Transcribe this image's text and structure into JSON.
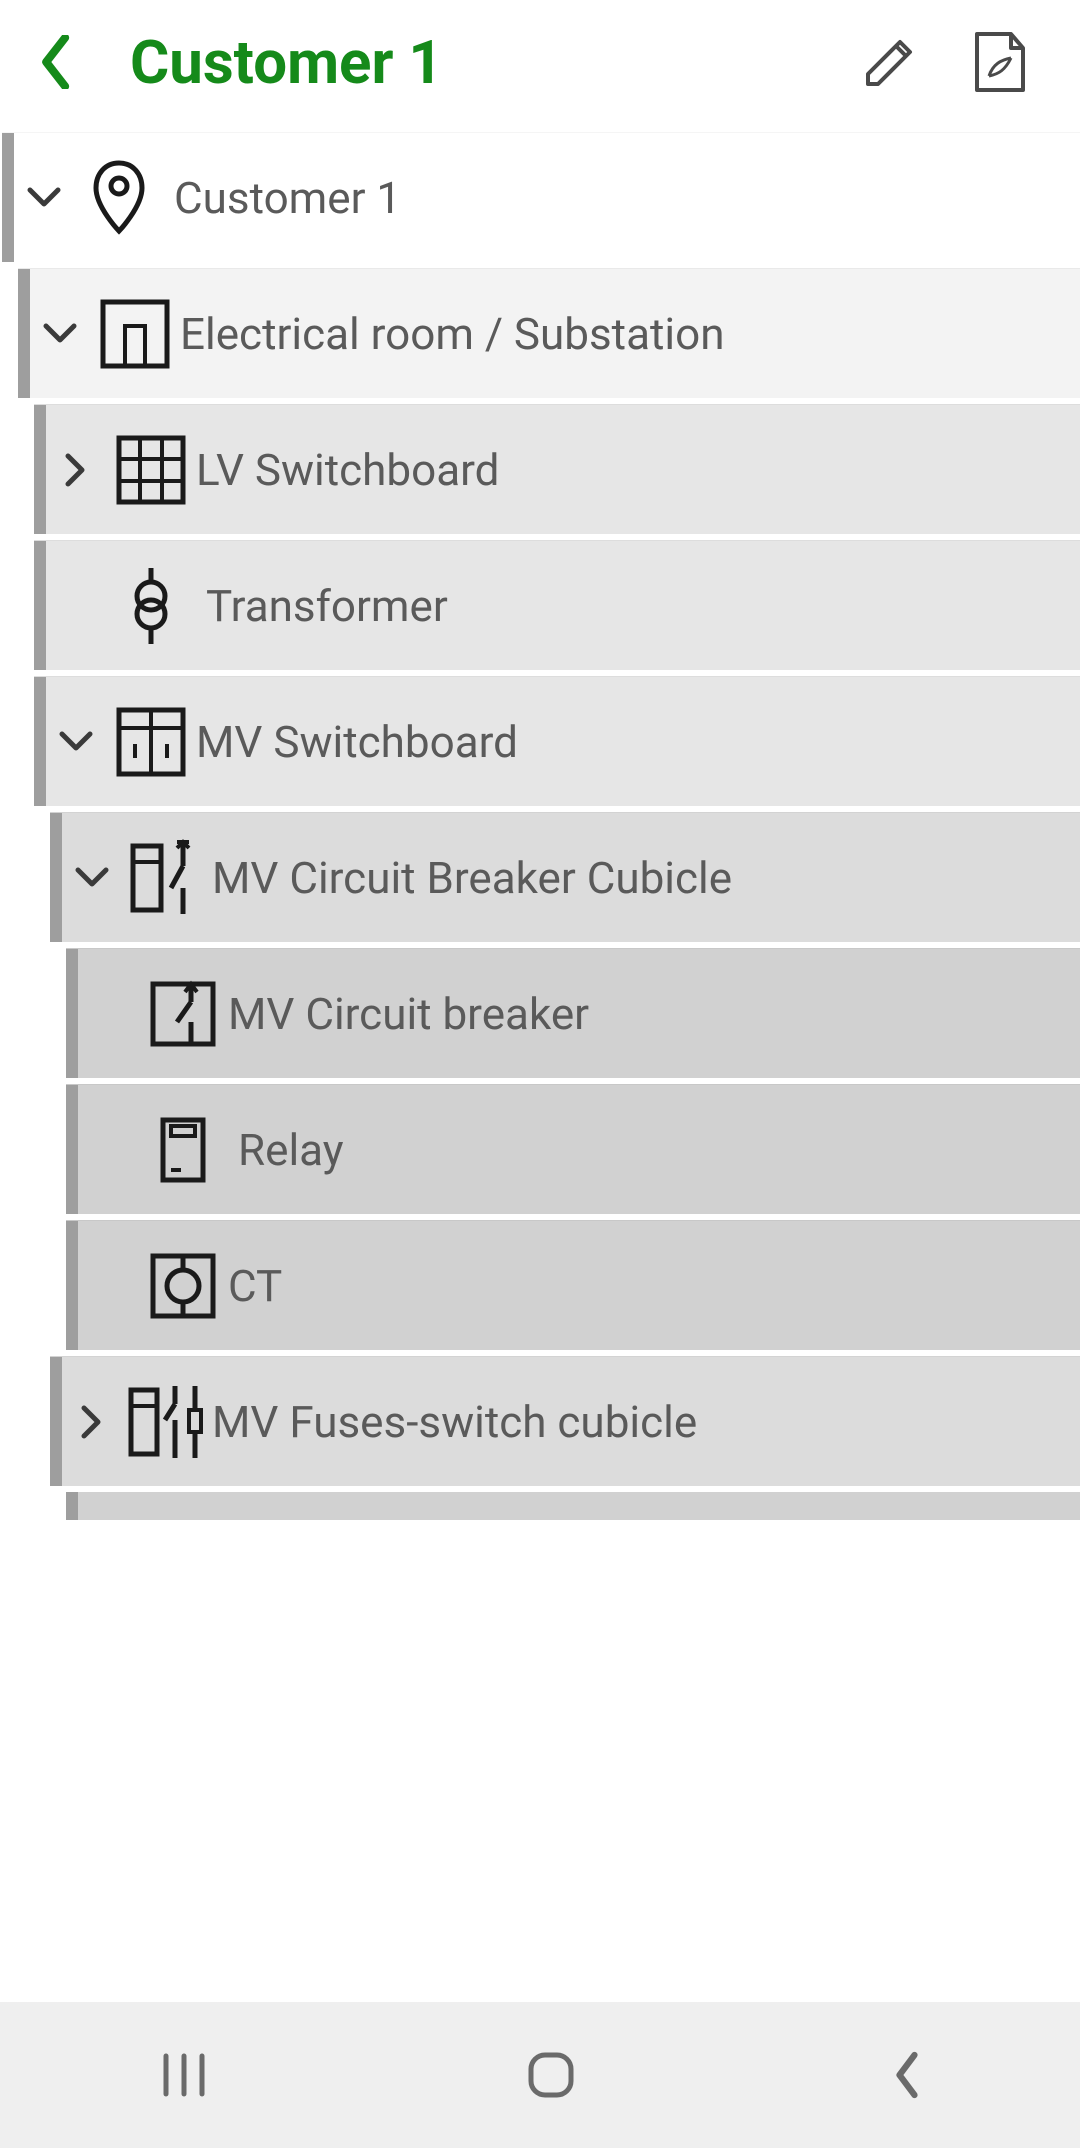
{
  "header": {
    "title": "Customer 1"
  },
  "tree": {
    "root": {
      "label": "Customer 1",
      "children": [
        {
          "label": "Electrical room / Substation",
          "children": [
            {
              "label": "LV Switchboard"
            },
            {
              "label": "Transformer"
            },
            {
              "label": "MV Switchboard",
              "children": [
                {
                  "label": "MV Circuit Breaker Cubicle",
                  "children": [
                    {
                      "label": "MV Circuit breaker"
                    },
                    {
                      "label": "Relay"
                    },
                    {
                      "label": "CT"
                    }
                  ]
                },
                {
                  "label": "MV Fuses-switch cubicle"
                }
              ]
            }
          ]
        }
      ]
    }
  }
}
